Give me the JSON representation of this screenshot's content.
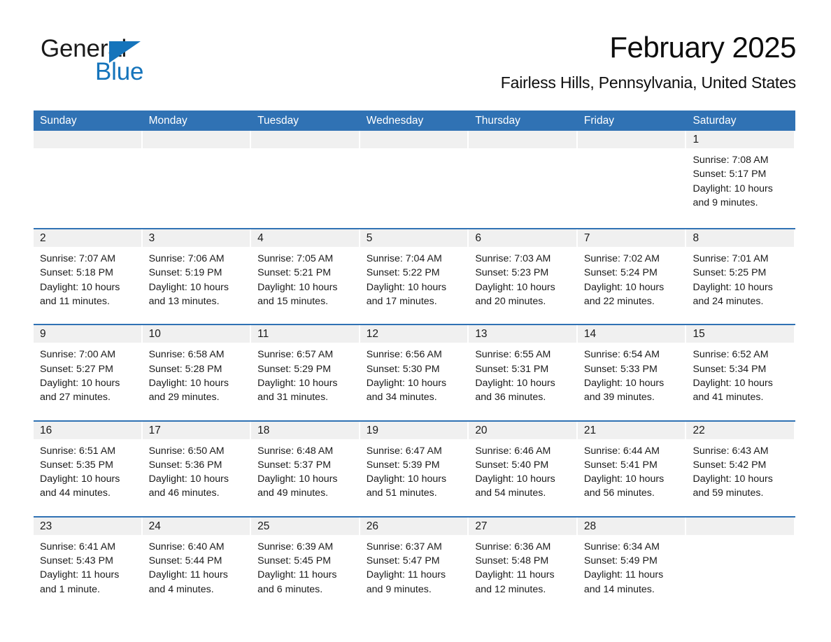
{
  "logo": {
    "word_one": "General",
    "word_two": "Blue",
    "triangle_color": "#1574bb",
    "text_color": "#1a1a1a"
  },
  "header": {
    "title": "February 2025",
    "subtitle": "Fairless Hills, Pennsylvania, United States"
  },
  "theme": {
    "header_blue": "#3072b4",
    "row_rule_blue": "#3072b4",
    "day_band_gray": "#f0f0f0",
    "background": "#ffffff",
    "text": "#1a1a1a"
  },
  "calendar": {
    "weekday_headers": [
      "Sunday",
      "Monday",
      "Tuesday",
      "Wednesday",
      "Thursday",
      "Friday",
      "Saturday"
    ],
    "weeks": [
      [
        {
          "blank": true
        },
        {
          "blank": true
        },
        {
          "blank": true
        },
        {
          "blank": true
        },
        {
          "blank": true
        },
        {
          "blank": true
        },
        {
          "day": "1",
          "sunrise": "Sunrise: 7:08 AM",
          "sunset": "Sunset: 5:17 PM",
          "daylight_line1": "Daylight: 10 hours",
          "daylight_line2": "and 9 minutes."
        }
      ],
      [
        {
          "day": "2",
          "sunrise": "Sunrise: 7:07 AM",
          "sunset": "Sunset: 5:18 PM",
          "daylight_line1": "Daylight: 10 hours",
          "daylight_line2": "and 11 minutes."
        },
        {
          "day": "3",
          "sunrise": "Sunrise: 7:06 AM",
          "sunset": "Sunset: 5:19 PM",
          "daylight_line1": "Daylight: 10 hours",
          "daylight_line2": "and 13 minutes."
        },
        {
          "day": "4",
          "sunrise": "Sunrise: 7:05 AM",
          "sunset": "Sunset: 5:21 PM",
          "daylight_line1": "Daylight: 10 hours",
          "daylight_line2": "and 15 minutes."
        },
        {
          "day": "5",
          "sunrise": "Sunrise: 7:04 AM",
          "sunset": "Sunset: 5:22 PM",
          "daylight_line1": "Daylight: 10 hours",
          "daylight_line2": "and 17 minutes."
        },
        {
          "day": "6",
          "sunrise": "Sunrise: 7:03 AM",
          "sunset": "Sunset: 5:23 PM",
          "daylight_line1": "Daylight: 10 hours",
          "daylight_line2": "and 20 minutes."
        },
        {
          "day": "7",
          "sunrise": "Sunrise: 7:02 AM",
          "sunset": "Sunset: 5:24 PM",
          "daylight_line1": "Daylight: 10 hours",
          "daylight_line2": "and 22 minutes."
        },
        {
          "day": "8",
          "sunrise": "Sunrise: 7:01 AM",
          "sunset": "Sunset: 5:25 PM",
          "daylight_line1": "Daylight: 10 hours",
          "daylight_line2": "and 24 minutes."
        }
      ],
      [
        {
          "day": "9",
          "sunrise": "Sunrise: 7:00 AM",
          "sunset": "Sunset: 5:27 PM",
          "daylight_line1": "Daylight: 10 hours",
          "daylight_line2": "and 27 minutes."
        },
        {
          "day": "10",
          "sunrise": "Sunrise: 6:58 AM",
          "sunset": "Sunset: 5:28 PM",
          "daylight_line1": "Daylight: 10 hours",
          "daylight_line2": "and 29 minutes."
        },
        {
          "day": "11",
          "sunrise": "Sunrise: 6:57 AM",
          "sunset": "Sunset: 5:29 PM",
          "daylight_line1": "Daylight: 10 hours",
          "daylight_line2": "and 31 minutes."
        },
        {
          "day": "12",
          "sunrise": "Sunrise: 6:56 AM",
          "sunset": "Sunset: 5:30 PM",
          "daylight_line1": "Daylight: 10 hours",
          "daylight_line2": "and 34 minutes."
        },
        {
          "day": "13",
          "sunrise": "Sunrise: 6:55 AM",
          "sunset": "Sunset: 5:31 PM",
          "daylight_line1": "Daylight: 10 hours",
          "daylight_line2": "and 36 minutes."
        },
        {
          "day": "14",
          "sunrise": "Sunrise: 6:54 AM",
          "sunset": "Sunset: 5:33 PM",
          "daylight_line1": "Daylight: 10 hours",
          "daylight_line2": "and 39 minutes."
        },
        {
          "day": "15",
          "sunrise": "Sunrise: 6:52 AM",
          "sunset": "Sunset: 5:34 PM",
          "daylight_line1": "Daylight: 10 hours",
          "daylight_line2": "and 41 minutes."
        }
      ],
      [
        {
          "day": "16",
          "sunrise": "Sunrise: 6:51 AM",
          "sunset": "Sunset: 5:35 PM",
          "daylight_line1": "Daylight: 10 hours",
          "daylight_line2": "and 44 minutes."
        },
        {
          "day": "17",
          "sunrise": "Sunrise: 6:50 AM",
          "sunset": "Sunset: 5:36 PM",
          "daylight_line1": "Daylight: 10 hours",
          "daylight_line2": "and 46 minutes."
        },
        {
          "day": "18",
          "sunrise": "Sunrise: 6:48 AM",
          "sunset": "Sunset: 5:37 PM",
          "daylight_line1": "Daylight: 10 hours",
          "daylight_line2": "and 49 minutes."
        },
        {
          "day": "19",
          "sunrise": "Sunrise: 6:47 AM",
          "sunset": "Sunset: 5:39 PM",
          "daylight_line1": "Daylight: 10 hours",
          "daylight_line2": "and 51 minutes."
        },
        {
          "day": "20",
          "sunrise": "Sunrise: 6:46 AM",
          "sunset": "Sunset: 5:40 PM",
          "daylight_line1": "Daylight: 10 hours",
          "daylight_line2": "and 54 minutes."
        },
        {
          "day": "21",
          "sunrise": "Sunrise: 6:44 AM",
          "sunset": "Sunset: 5:41 PM",
          "daylight_line1": "Daylight: 10 hours",
          "daylight_line2": "and 56 minutes."
        },
        {
          "day": "22",
          "sunrise": "Sunrise: 6:43 AM",
          "sunset": "Sunset: 5:42 PM",
          "daylight_line1": "Daylight: 10 hours",
          "daylight_line2": "and 59 minutes."
        }
      ],
      [
        {
          "day": "23",
          "sunrise": "Sunrise: 6:41 AM",
          "sunset": "Sunset: 5:43 PM",
          "daylight_line1": "Daylight: 11 hours",
          "daylight_line2": "and 1 minute."
        },
        {
          "day": "24",
          "sunrise": "Sunrise: 6:40 AM",
          "sunset": "Sunset: 5:44 PM",
          "daylight_line1": "Daylight: 11 hours",
          "daylight_line2": "and 4 minutes."
        },
        {
          "day": "25",
          "sunrise": "Sunrise: 6:39 AM",
          "sunset": "Sunset: 5:45 PM",
          "daylight_line1": "Daylight: 11 hours",
          "daylight_line2": "and 6 minutes."
        },
        {
          "day": "26",
          "sunrise": "Sunrise: 6:37 AM",
          "sunset": "Sunset: 5:47 PM",
          "daylight_line1": "Daylight: 11 hours",
          "daylight_line2": "and 9 minutes."
        },
        {
          "day": "27",
          "sunrise": "Sunrise: 6:36 AM",
          "sunset": "Sunset: 5:48 PM",
          "daylight_line1": "Daylight: 11 hours",
          "daylight_line2": "and 12 minutes."
        },
        {
          "day": "28",
          "sunrise": "Sunrise: 6:34 AM",
          "sunset": "Sunset: 5:49 PM",
          "daylight_line1": "Daylight: 11 hours",
          "daylight_line2": "and 14 minutes."
        },
        {
          "blank": true
        }
      ]
    ]
  }
}
